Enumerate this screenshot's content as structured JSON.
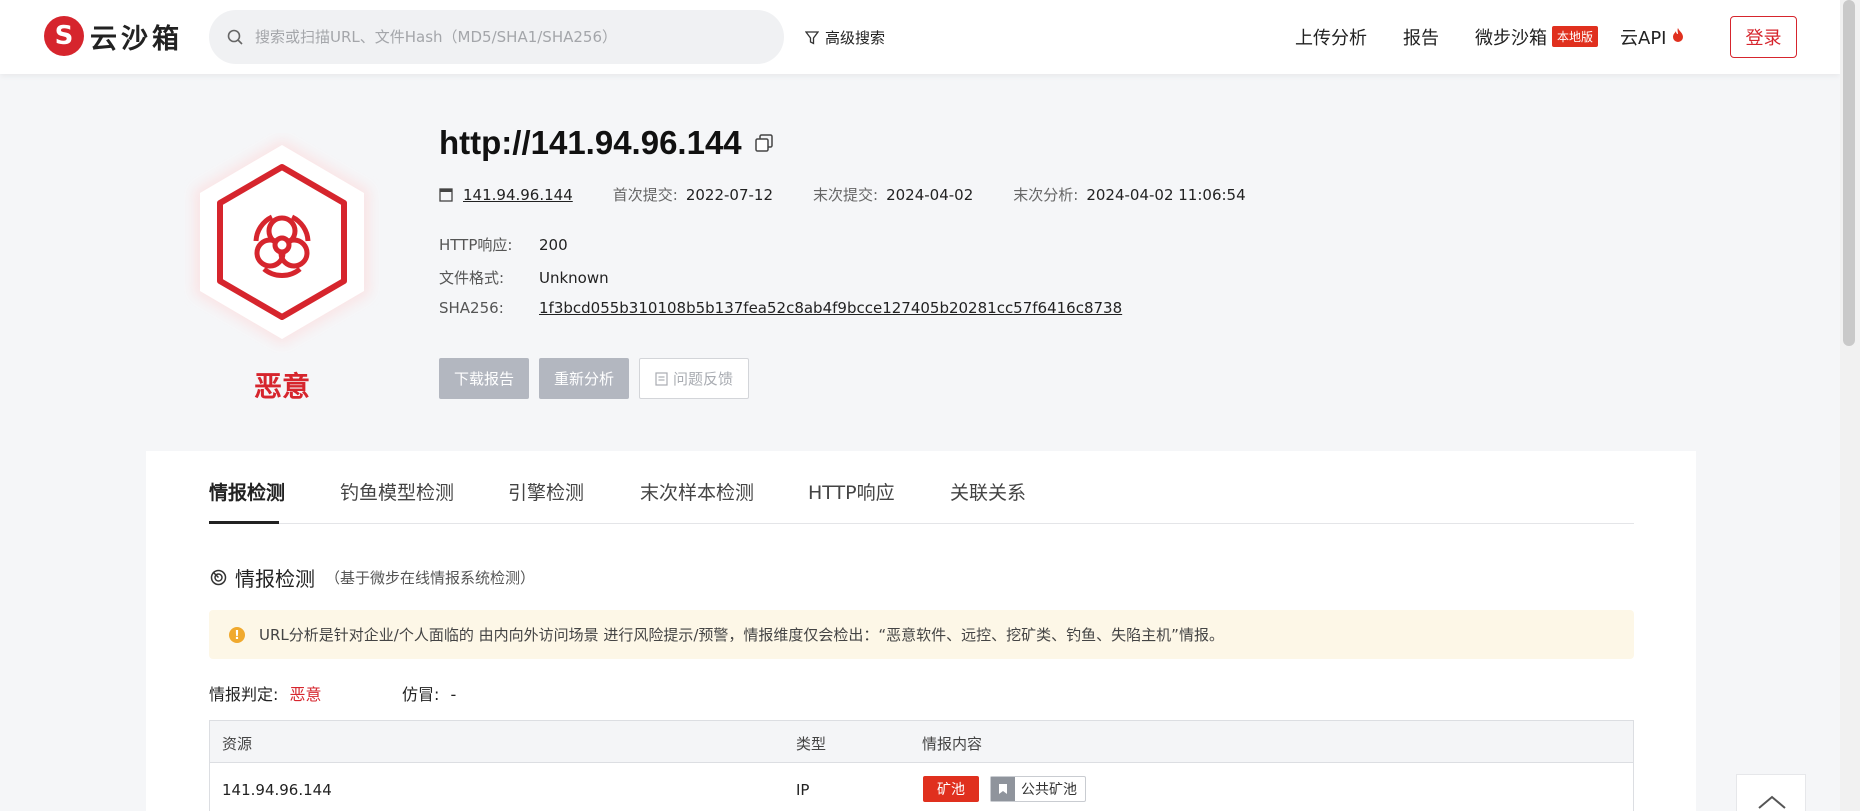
{
  "header": {
    "logo_text": "云沙箱",
    "search_placeholder": "搜索或扫描URL、文件Hash（MD5/SHA1/SHA256）",
    "advanced_search": "高级搜索",
    "nav": {
      "upload": "上传分析",
      "report": "报告",
      "sandbox": "微步沙箱",
      "sandbox_badge": "本地版",
      "api": "云API",
      "login": "登录"
    }
  },
  "summary": {
    "verdict": "恶意",
    "url": "http://141.94.96.144",
    "host": "141.94.96.144",
    "first_submit_label": "首次提交:",
    "first_submit": "2022-07-12",
    "last_submit_label": "末次提交:",
    "last_submit": "2024-04-02",
    "last_analysis_label": "末次分析:",
    "last_analysis": "2024-04-02 11:06:54",
    "http_label": "HTTP响应:",
    "http_value": "200",
    "format_label": "文件格式:",
    "format_value": "Unknown",
    "sha_label": "SHA256:",
    "sha_value": "1f3bcd055b310108b5b137fea52c8ab4f9bcce127405b20281cc57f6416c8738",
    "buttons": {
      "download": "下载报告",
      "reanalyze": "重新分析",
      "feedback": "问题反馈"
    }
  },
  "tabs": [
    "情报检测",
    "钓鱼模型检测",
    "引擎检测",
    "末次样本检测",
    "HTTP响应",
    "关联关系"
  ],
  "intel": {
    "title": "情报检测",
    "subtitle": "（基于微步在线情报系统检测）",
    "notice": "URL分析是针对企业/个人面临的 由内向外访问场景 进行风险提示/预警，情报维度仅会检出：“恶意软件、远控、挖矿类、钓鱼、失陷主机”情报。",
    "judge_label": "情报判定:",
    "judge_value": "恶意",
    "imitate_label": "仿冒:",
    "imitate_value": "-",
    "table": {
      "headers": [
        "资源",
        "类型",
        "情报内容"
      ],
      "rows": [
        {
          "resource": "141.94.96.144",
          "type": "IP",
          "tag": "矿池",
          "tag2": "公共矿池"
        }
      ]
    }
  },
  "colors": {
    "brand_red": "#d6252d",
    "notice_bg": "#fdf7e7",
    "button_gray": "#b3b7c0"
  }
}
